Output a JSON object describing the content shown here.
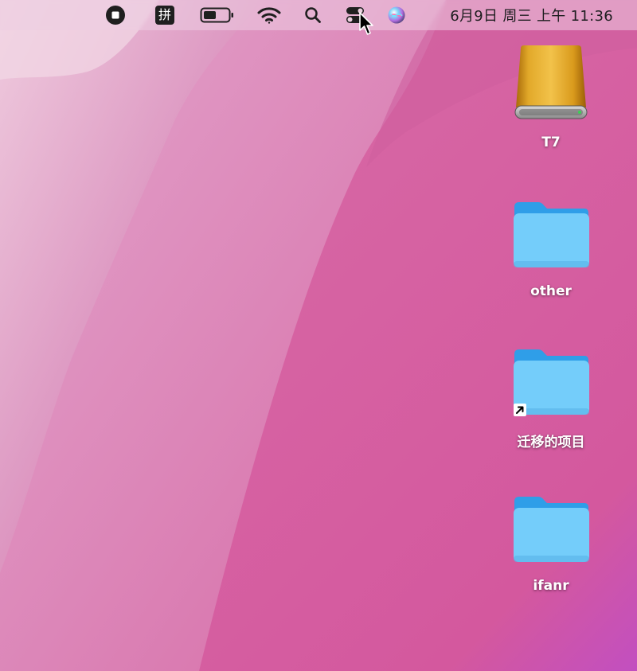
{
  "menubar": {
    "ime_label": "拼",
    "clock": "6月9日 周三 上午 11:36",
    "icons": [
      "screen-record-stop-icon",
      "input-method-icon",
      "battery-icon",
      "wifi-icon",
      "spotlight-search-icon",
      "control-center-icon",
      "siri-icon"
    ]
  },
  "desktop": {
    "items": [
      {
        "label": "T7",
        "type": "external-drive"
      },
      {
        "label": "other",
        "type": "folder"
      },
      {
        "label": "迁移的项目",
        "type": "folder-alias"
      },
      {
        "label": "ifanr",
        "type": "folder"
      }
    ]
  },
  "colors": {
    "wallpaper_base": "#d8649f",
    "wallpaper_light": "#e7b6d2",
    "folder_body": "#74cdfa",
    "folder_tab": "#2f9ee8",
    "drive_gold": "#d9a021"
  }
}
